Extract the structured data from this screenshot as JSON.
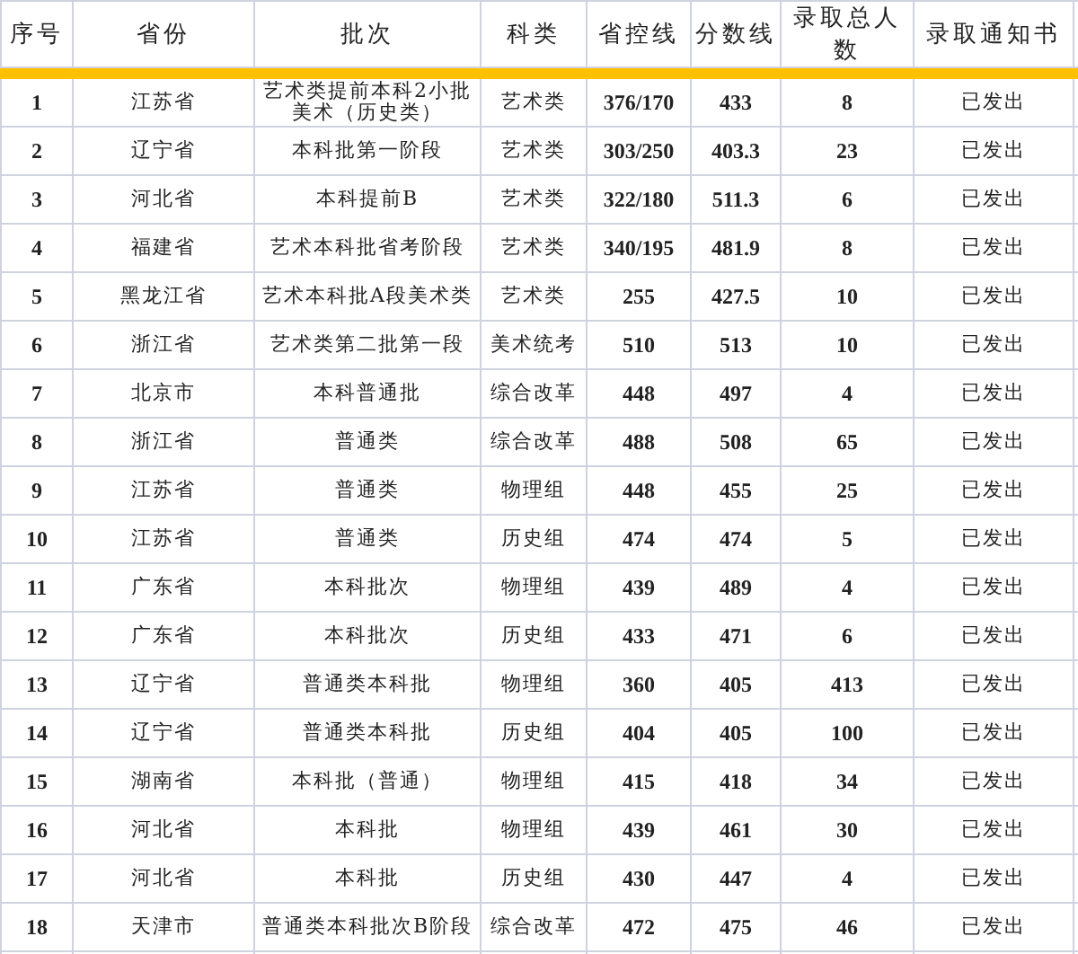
{
  "table": {
    "columns": [
      "序号",
      "省份",
      "批次",
      "科类",
      "省控线",
      "分数线",
      "录取总人数",
      "录取通知书"
    ],
    "rows": [
      [
        "1",
        "江苏省",
        "艺术类提前本科2小批美术（历史类）",
        "艺术类",
        "376/170",
        "433",
        "8",
        "已发出"
      ],
      [
        "2",
        "辽宁省",
        "本科批第一阶段",
        "艺术类",
        "303/250",
        "403.3",
        "23",
        "已发出"
      ],
      [
        "3",
        "河北省",
        "本科提前B",
        "艺术类",
        "322/180",
        "511.3",
        "6",
        "已发出"
      ],
      [
        "4",
        "福建省",
        "艺术本科批省考阶段",
        "艺术类",
        "340/195",
        "481.9",
        "8",
        "已发出"
      ],
      [
        "5",
        "黑龙江省",
        "艺术本科批A段美术类",
        "艺术类",
        "255",
        "427.5",
        "10",
        "已发出"
      ],
      [
        "6",
        "浙江省",
        "艺术类第二批第一段",
        "美术统考",
        "510",
        "513",
        "10",
        "已发出"
      ],
      [
        "7",
        "北京市",
        "本科普通批",
        "综合改革",
        "448",
        "497",
        "4",
        "已发出"
      ],
      [
        "8",
        "浙江省",
        "普通类",
        "综合改革",
        "488",
        "508",
        "65",
        "已发出"
      ],
      [
        "9",
        "江苏省",
        "普通类",
        "物理组",
        "448",
        "455",
        "25",
        "已发出"
      ],
      [
        "10",
        "江苏省",
        "普通类",
        "历史组",
        "474",
        "474",
        "5",
        "已发出"
      ],
      [
        "11",
        "广东省",
        "本科批次",
        "物理组",
        "439",
        "489",
        "4",
        "已发出"
      ],
      [
        "12",
        "广东省",
        "本科批次",
        "历史组",
        "433",
        "471",
        "6",
        "已发出"
      ],
      [
        "13",
        "辽宁省",
        "普通类本科批",
        "物理组",
        "360",
        "405",
        "413",
        "已发出"
      ],
      [
        "14",
        "辽宁省",
        "普通类本科批",
        "历史组",
        "404",
        "405",
        "100",
        "已发出"
      ],
      [
        "15",
        "湖南省",
        "本科批（普通）",
        "物理组",
        "415",
        "418",
        "34",
        "已发出"
      ],
      [
        "16",
        "河北省",
        "本科批",
        "物理组",
        "439",
        "461",
        "30",
        "已发出"
      ],
      [
        "17",
        "河北省",
        "本科批",
        "历史组",
        "430",
        "447",
        "4",
        "已发出"
      ],
      [
        "18",
        "天津市",
        "普通类本科批次B阶段",
        "综合改革",
        "472",
        "475",
        "46",
        "已发出"
      ]
    ]
  }
}
